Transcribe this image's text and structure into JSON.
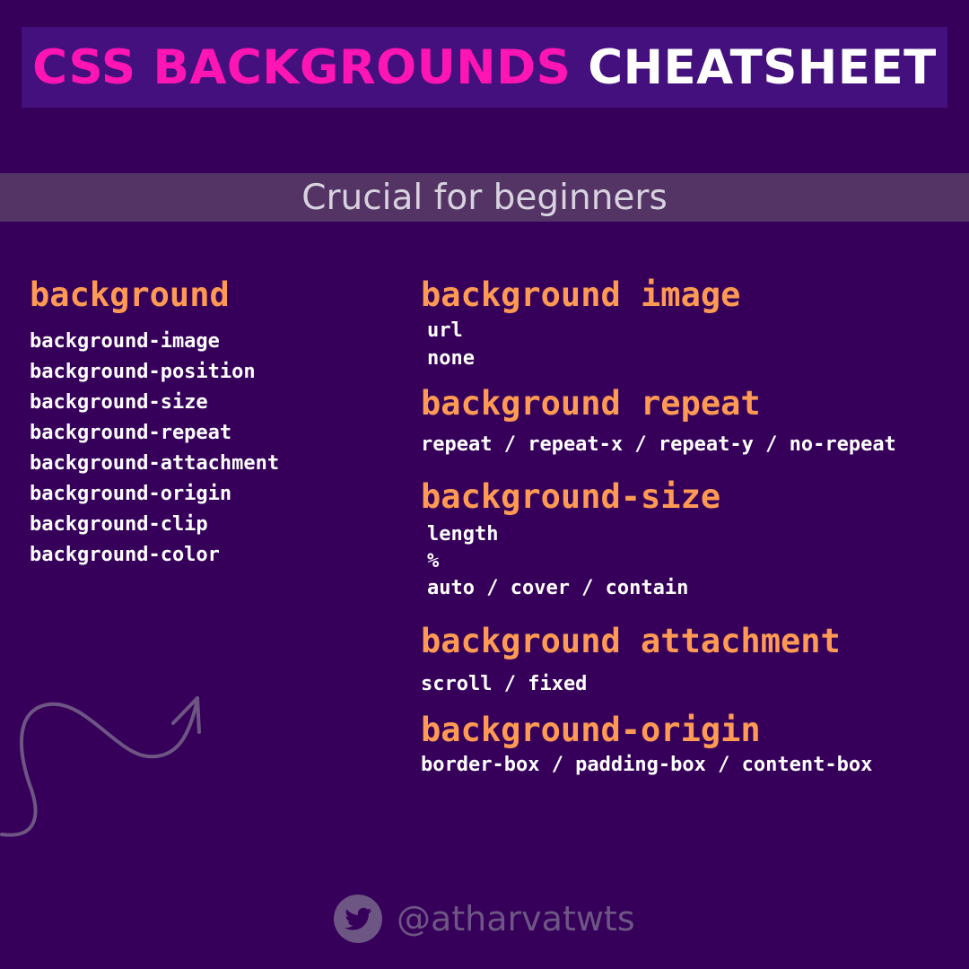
{
  "title": {
    "part1": "CSS BACKGROUNDS",
    "part2": "CHEATSHEET"
  },
  "subtitle": "Crucial for beginners",
  "left_section": {
    "heading": "background",
    "items": [
      "background-image",
      "background-position",
      "background-size",
      "background-repeat",
      "background-attachment",
      "background-origin",
      "background-clip",
      "background-color"
    ]
  },
  "right_sections": {
    "image": {
      "heading": "background image",
      "values": [
        "url",
        "none"
      ]
    },
    "repeat": {
      "heading": "background repeat",
      "values": [
        "repeat / repeat-x / repeat-y / no-repeat"
      ]
    },
    "size": {
      "heading": "background-size",
      "values": [
        "length",
        "%",
        "auto / cover / contain"
      ]
    },
    "attachment": {
      "heading": "background attachment",
      "values": [
        "scroll / fixed"
      ]
    },
    "origin": {
      "heading": "background-origin",
      "values": [
        "border-box / padding-box / content-box"
      ]
    }
  },
  "footer": {
    "icon": "twitter-icon",
    "handle": "@atharvatwts"
  },
  "colors": {
    "background": "#36005a",
    "title_banner": "#44107e",
    "title_accent": "#ff15b4",
    "heading": "#ff9a54",
    "subtitle_band": "#533465",
    "muted": "#6d5683"
  }
}
